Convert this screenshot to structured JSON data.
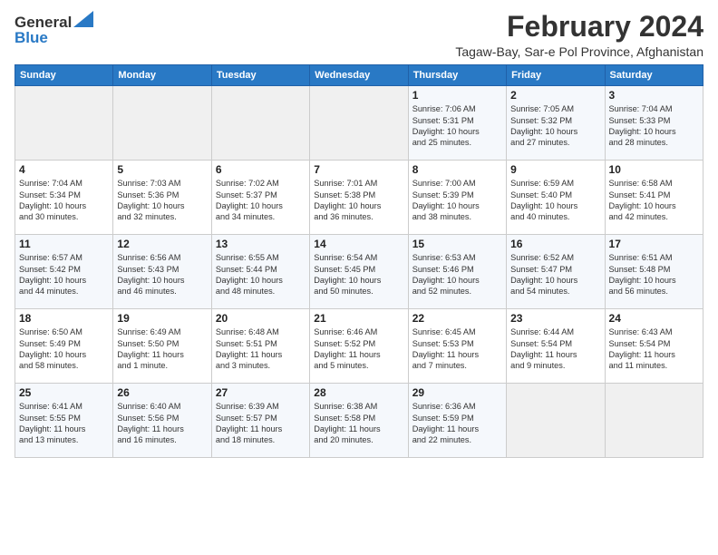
{
  "logo": {
    "line1": "General",
    "line2": "Blue"
  },
  "header": {
    "month": "February 2024",
    "location": "Tagaw-Bay, Sar-e Pol Province, Afghanistan"
  },
  "weekdays": [
    "Sunday",
    "Monday",
    "Tuesday",
    "Wednesday",
    "Thursday",
    "Friday",
    "Saturday"
  ],
  "weeks": [
    [
      {
        "day": "",
        "detail": ""
      },
      {
        "day": "",
        "detail": ""
      },
      {
        "day": "",
        "detail": ""
      },
      {
        "day": "",
        "detail": ""
      },
      {
        "day": "1",
        "detail": "Sunrise: 7:06 AM\nSunset: 5:31 PM\nDaylight: 10 hours\nand 25 minutes."
      },
      {
        "day": "2",
        "detail": "Sunrise: 7:05 AM\nSunset: 5:32 PM\nDaylight: 10 hours\nand 27 minutes."
      },
      {
        "day": "3",
        "detail": "Sunrise: 7:04 AM\nSunset: 5:33 PM\nDaylight: 10 hours\nand 28 minutes."
      }
    ],
    [
      {
        "day": "4",
        "detail": "Sunrise: 7:04 AM\nSunset: 5:34 PM\nDaylight: 10 hours\nand 30 minutes."
      },
      {
        "day": "5",
        "detail": "Sunrise: 7:03 AM\nSunset: 5:36 PM\nDaylight: 10 hours\nand 32 minutes."
      },
      {
        "day": "6",
        "detail": "Sunrise: 7:02 AM\nSunset: 5:37 PM\nDaylight: 10 hours\nand 34 minutes."
      },
      {
        "day": "7",
        "detail": "Sunrise: 7:01 AM\nSunset: 5:38 PM\nDaylight: 10 hours\nand 36 minutes."
      },
      {
        "day": "8",
        "detail": "Sunrise: 7:00 AM\nSunset: 5:39 PM\nDaylight: 10 hours\nand 38 minutes."
      },
      {
        "day": "9",
        "detail": "Sunrise: 6:59 AM\nSunset: 5:40 PM\nDaylight: 10 hours\nand 40 minutes."
      },
      {
        "day": "10",
        "detail": "Sunrise: 6:58 AM\nSunset: 5:41 PM\nDaylight: 10 hours\nand 42 minutes."
      }
    ],
    [
      {
        "day": "11",
        "detail": "Sunrise: 6:57 AM\nSunset: 5:42 PM\nDaylight: 10 hours\nand 44 minutes."
      },
      {
        "day": "12",
        "detail": "Sunrise: 6:56 AM\nSunset: 5:43 PM\nDaylight: 10 hours\nand 46 minutes."
      },
      {
        "day": "13",
        "detail": "Sunrise: 6:55 AM\nSunset: 5:44 PM\nDaylight: 10 hours\nand 48 minutes."
      },
      {
        "day": "14",
        "detail": "Sunrise: 6:54 AM\nSunset: 5:45 PM\nDaylight: 10 hours\nand 50 minutes."
      },
      {
        "day": "15",
        "detail": "Sunrise: 6:53 AM\nSunset: 5:46 PM\nDaylight: 10 hours\nand 52 minutes."
      },
      {
        "day": "16",
        "detail": "Sunrise: 6:52 AM\nSunset: 5:47 PM\nDaylight: 10 hours\nand 54 minutes."
      },
      {
        "day": "17",
        "detail": "Sunrise: 6:51 AM\nSunset: 5:48 PM\nDaylight: 10 hours\nand 56 minutes."
      }
    ],
    [
      {
        "day": "18",
        "detail": "Sunrise: 6:50 AM\nSunset: 5:49 PM\nDaylight: 10 hours\nand 58 minutes."
      },
      {
        "day": "19",
        "detail": "Sunrise: 6:49 AM\nSunset: 5:50 PM\nDaylight: 11 hours\nand 1 minute."
      },
      {
        "day": "20",
        "detail": "Sunrise: 6:48 AM\nSunset: 5:51 PM\nDaylight: 11 hours\nand 3 minutes."
      },
      {
        "day": "21",
        "detail": "Sunrise: 6:46 AM\nSunset: 5:52 PM\nDaylight: 11 hours\nand 5 minutes."
      },
      {
        "day": "22",
        "detail": "Sunrise: 6:45 AM\nSunset: 5:53 PM\nDaylight: 11 hours\nand 7 minutes."
      },
      {
        "day": "23",
        "detail": "Sunrise: 6:44 AM\nSunset: 5:54 PM\nDaylight: 11 hours\nand 9 minutes."
      },
      {
        "day": "24",
        "detail": "Sunrise: 6:43 AM\nSunset: 5:54 PM\nDaylight: 11 hours\nand 11 minutes."
      }
    ],
    [
      {
        "day": "25",
        "detail": "Sunrise: 6:41 AM\nSunset: 5:55 PM\nDaylight: 11 hours\nand 13 minutes."
      },
      {
        "day": "26",
        "detail": "Sunrise: 6:40 AM\nSunset: 5:56 PM\nDaylight: 11 hours\nand 16 minutes."
      },
      {
        "day": "27",
        "detail": "Sunrise: 6:39 AM\nSunset: 5:57 PM\nDaylight: 11 hours\nand 18 minutes."
      },
      {
        "day": "28",
        "detail": "Sunrise: 6:38 AM\nSunset: 5:58 PM\nDaylight: 11 hours\nand 20 minutes."
      },
      {
        "day": "29",
        "detail": "Sunrise: 6:36 AM\nSunset: 5:59 PM\nDaylight: 11 hours\nand 22 minutes."
      },
      {
        "day": "",
        "detail": ""
      },
      {
        "day": "",
        "detail": ""
      }
    ]
  ]
}
